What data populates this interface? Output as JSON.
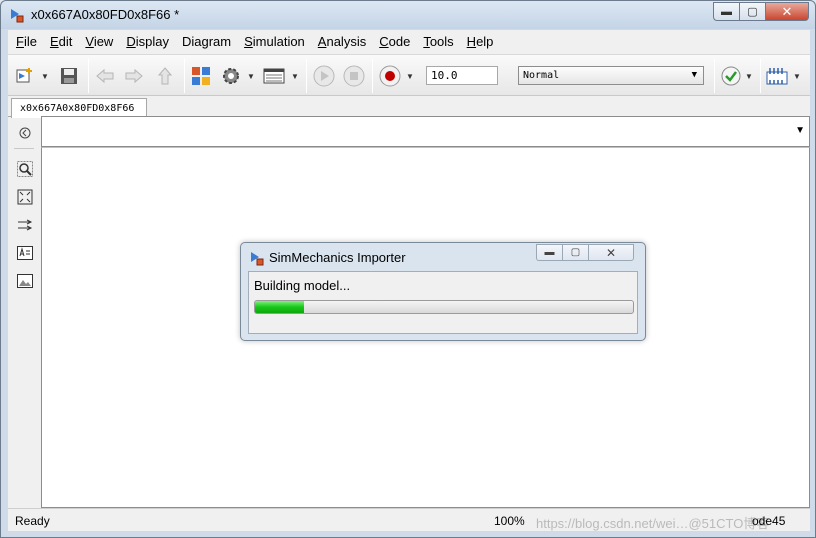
{
  "window": {
    "title": "x0x667A0x80FD0x8F66 *",
    "min_glyph": "▬",
    "max_glyph": "▢",
    "close_glyph": "✕"
  },
  "menu": [
    {
      "key": "F",
      "rest": "ile"
    },
    {
      "key": "E",
      "rest": "dit"
    },
    {
      "key": "V",
      "rest": "iew"
    },
    {
      "key": "D",
      "rest": "isplay"
    },
    {
      "key": "",
      "rest": "Diagram"
    },
    {
      "key": "S",
      "rest": "imulation"
    },
    {
      "key": "A",
      "rest": "nalysis"
    },
    {
      "key": "C",
      "rest": "ode"
    },
    {
      "key": "T",
      "rest": "ools"
    },
    {
      "key": "H",
      "rest": "elp"
    }
  ],
  "toolbar": {
    "stop_time": "10.0",
    "sim_mode": "Normal"
  },
  "tab": {
    "label": "x0x667A0x80FD0x8F66"
  },
  "status": {
    "left": "Ready",
    "zoom": "100%",
    "solver": "ode45",
    "watermark": "https://blog.csdn.net/wei…@51CTO博客"
  },
  "dialog": {
    "title": "SimMechanics Importer",
    "message": "Building model...",
    "progress": 0.13
  },
  "colors": {
    "progress_green": "#18c818",
    "record_red": "#c00000"
  },
  "icons": [
    "model-icon",
    "new-model-icon",
    "save-icon",
    "back-icon",
    "forward-icon",
    "up-icon",
    "library-browser-icon",
    "settings-gear-icon",
    "model-explorer-icon",
    "run-icon",
    "stop-icon",
    "record-icon",
    "check-icon",
    "build-icon",
    "hide-browser-icon",
    "zoom-icon",
    "fit-view-icon",
    "arrow-icon",
    "annotation-icon",
    "image-icon"
  ]
}
